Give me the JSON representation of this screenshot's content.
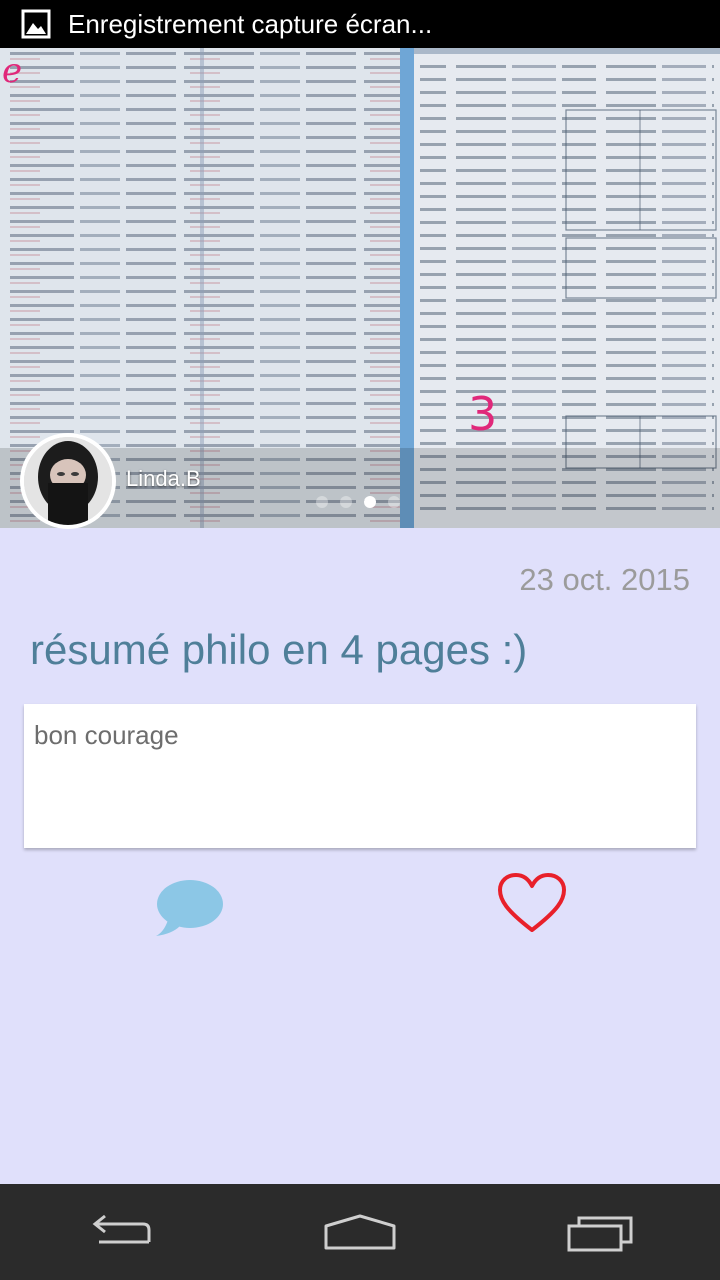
{
  "status_bar": {
    "icon": "image-icon",
    "notification_text": "Enregistrement capture écran..."
  },
  "photo": {
    "author_name": "Linda.B",
    "page_indicator": {
      "count": 4,
      "active_index": 2
    },
    "handwritten_marks": [
      "e",
      "3"
    ]
  },
  "post": {
    "date": "23 oct. 2015",
    "title": "résumé philo en 4 pages :)",
    "comment_text": "bon courage"
  },
  "actions": {
    "comment_icon": "speech-bubble-icon",
    "like_icon": "heart-icon",
    "comment_color": "#8cc7e6",
    "like_color": "#e8202a"
  },
  "nav_bar": {
    "back_icon": "back-icon",
    "home_icon": "home-icon",
    "recents_icon": "recents-icon"
  },
  "colors": {
    "background": "#e0e0fb",
    "title": "#4f7f99",
    "date": "#9b9b9b",
    "status_bar": "#000000",
    "nav_bar": "#2b2b2b"
  }
}
